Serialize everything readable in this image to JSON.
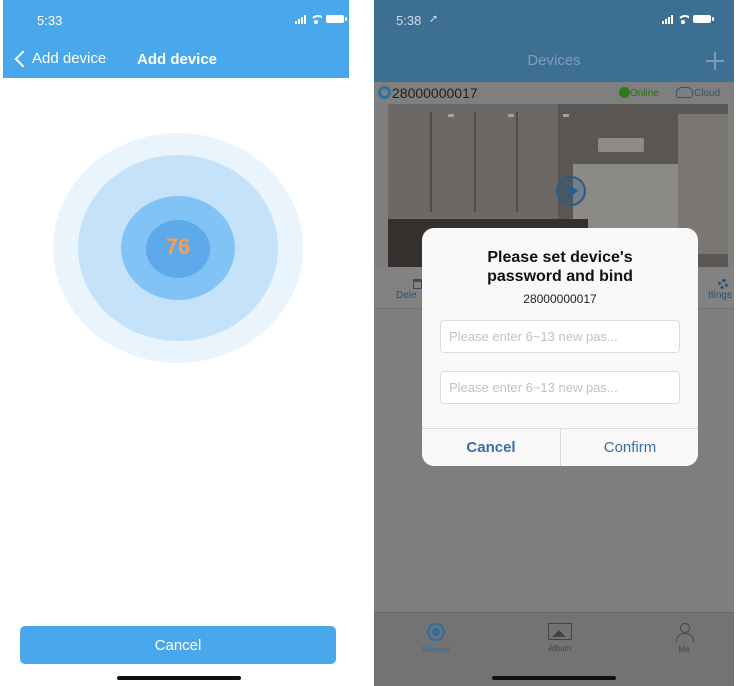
{
  "left_screen": {
    "status_time": "5:33",
    "back_label": "Add device",
    "title": "Add device",
    "progress_value": "76",
    "cancel_label": "Cancel",
    "colors": {
      "header": "#49a7ec",
      "progress_text": "#f7a04a"
    }
  },
  "right_screen": {
    "status_time": "5:38",
    "title": "Devices",
    "device": {
      "id": "28000000017",
      "status": "Online",
      "cloud_label": "Cloud"
    },
    "actions": {
      "delete_label": "Dele",
      "settings_label": "ttings"
    },
    "dialog": {
      "title": "Please set device's password and bind",
      "subtitle": "28000000017",
      "password_placeholder": "Please enter 6~13 new pas...",
      "confirm_placeholder": "Please enter 6~13 new pas...",
      "cancel_label": "Cancel",
      "confirm_label": "Confirm"
    },
    "tabs": [
      {
        "label": "Devices",
        "icon": "camera-icon",
        "active": true
      },
      {
        "label": "Album",
        "icon": "image-icon",
        "active": false
      },
      {
        "label": "Me",
        "icon": "person-icon",
        "active": false
      }
    ],
    "colors": {
      "accent": "#3a6ea5",
      "online": "#2e7a19"
    }
  }
}
